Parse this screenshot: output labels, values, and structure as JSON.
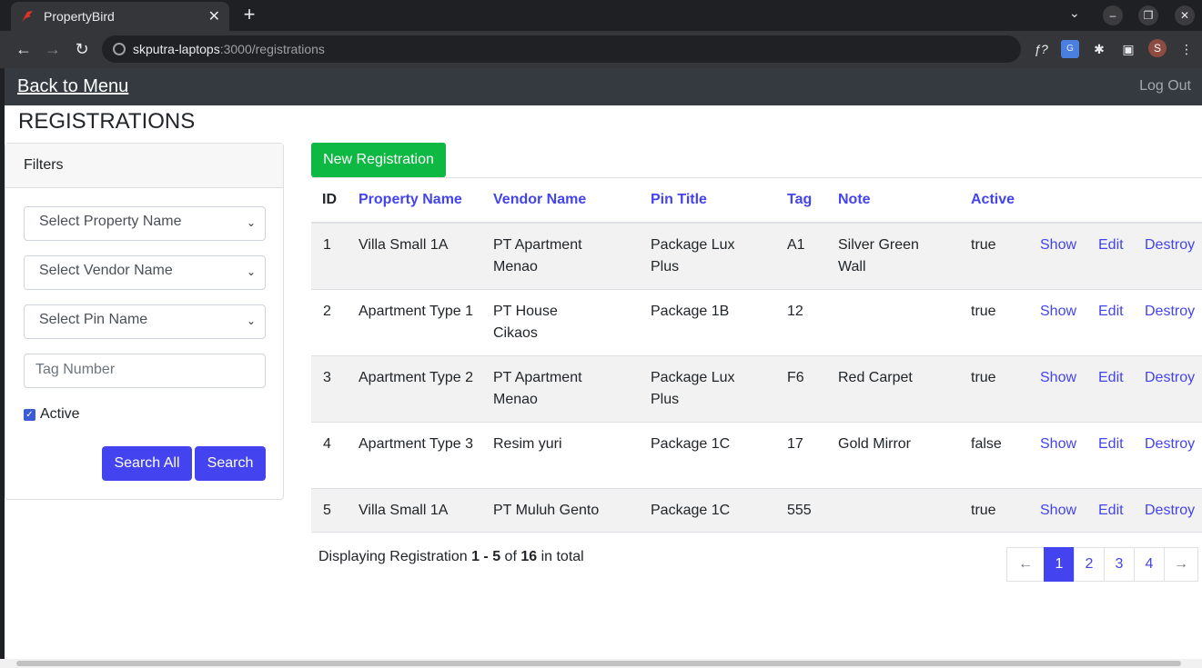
{
  "browser": {
    "tab_title": "PropertyBird",
    "tab_close": "✕",
    "new_tab": "+",
    "url_host": "skputra-laptops",
    "url_path": ":3000/registrations",
    "avatar_letter": "S"
  },
  "navbar": {
    "back_label": "Back to Menu",
    "logout_label": "Log Out"
  },
  "page": {
    "title": "REGISTRATIONS"
  },
  "filters": {
    "header": "Filters",
    "property_select": "Select Property Name",
    "vendor_select": "Select Vendor Name",
    "pin_select": "Select Pin Name",
    "tag_placeholder": "Tag Number",
    "active_label": "Active",
    "active_checked": true,
    "search_all_label": "Search All",
    "search_label": "Search"
  },
  "main": {
    "new_button": "New Registration",
    "columns": [
      "ID",
      "Property Name",
      "Vendor Name",
      "Pin Title",
      "Tag",
      "Note",
      "Active"
    ],
    "rows": [
      {
        "id": "1",
        "property": "Villa Small 1A",
        "vendor": "PT Apartment Menao",
        "pin": "Package Lux Plus",
        "tag": "A1",
        "note": "Silver Green Wall",
        "active": "true"
      },
      {
        "id": "2",
        "property": "Apartment Type 1",
        "vendor": "PT House Cikaos",
        "pin": "Package 1B",
        "tag": "12",
        "note": "",
        "active": "true"
      },
      {
        "id": "3",
        "property": "Apartment Type 2",
        "vendor": "PT Apartment Menao",
        "pin": "Package Lux Plus",
        "tag": "F6",
        "note": "Red Carpet",
        "active": "true"
      },
      {
        "id": "4",
        "property": "Apartment Type 3",
        "vendor": "Resim yuri",
        "pin": "Package 1C",
        "tag": "17",
        "note": "Gold Mirror",
        "active": "false"
      },
      {
        "id": "5",
        "property": "Villa Small 1A",
        "vendor": "PT Muluh Gento",
        "pin": "Package 1C",
        "tag": "555",
        "note": "",
        "active": "true"
      }
    ],
    "actions": {
      "show": "Show",
      "edit": "Edit",
      "destroy": "Destroy"
    },
    "summary": {
      "prefix": "Displaying Registration ",
      "range": "1 - 5",
      "of": " of ",
      "total": "16",
      "suffix": " in total"
    },
    "pagination": {
      "prev": "←",
      "pages": [
        "1",
        "2",
        "3",
        "4"
      ],
      "current": "1",
      "next": "→"
    }
  }
}
